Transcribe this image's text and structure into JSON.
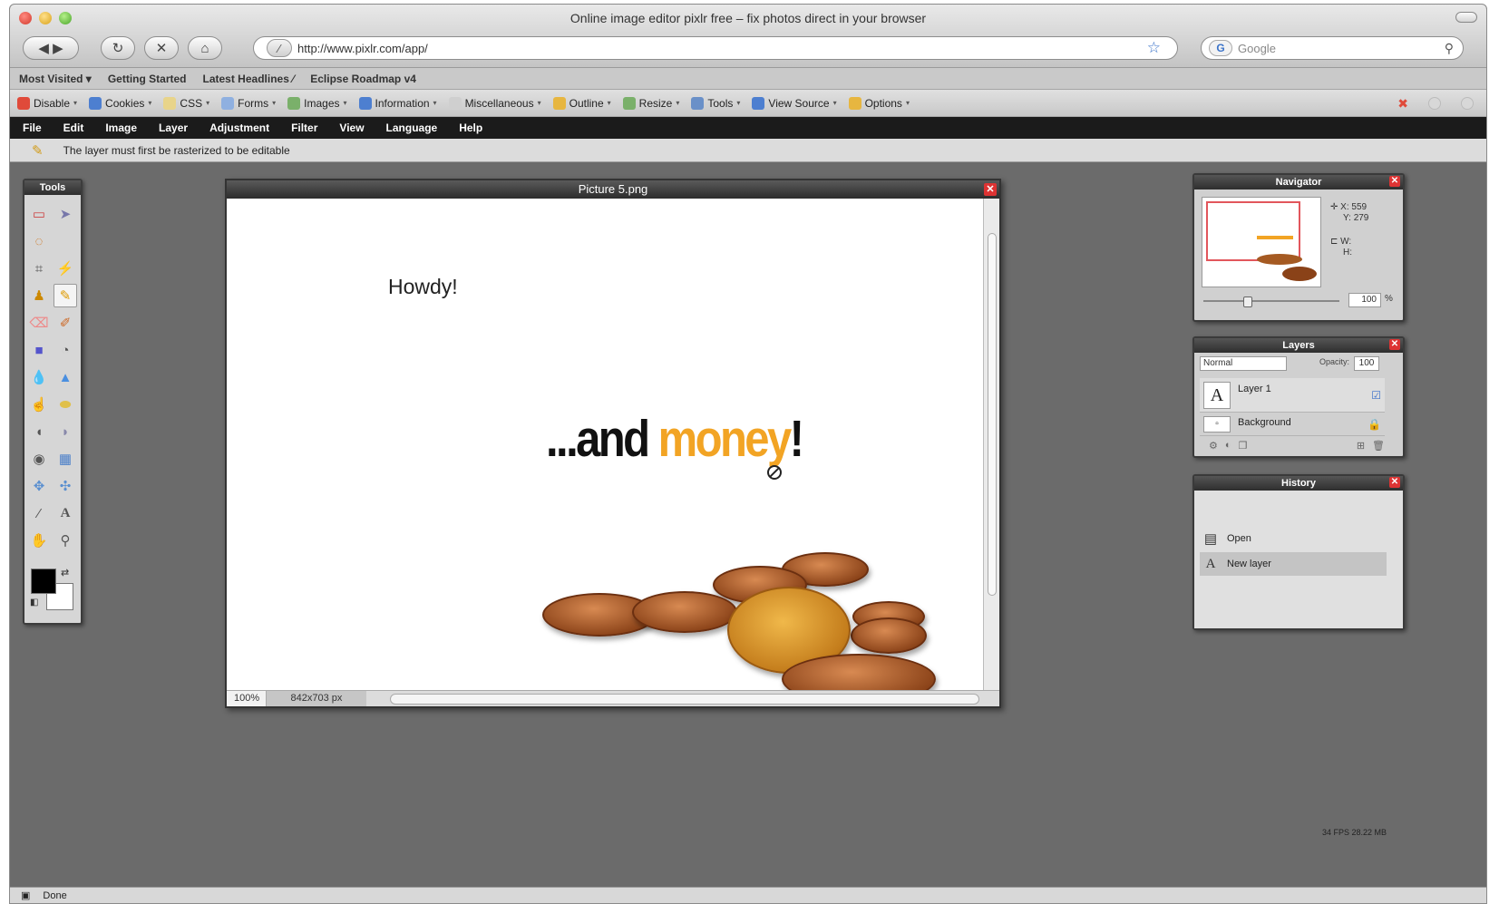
{
  "browser": {
    "window_title": "Online image editor pixlr free – fix photos direct in your browser",
    "url": "http://www.pixlr.com/app/",
    "search_placeholder": "Google",
    "search_engine_letter": "G",
    "status": "Done"
  },
  "bookmarks": [
    "Most Visited ▾",
    "Getting Started",
    "Latest Headlines ⁄",
    "Eclipse Roadmap v4"
  ],
  "devbar": [
    {
      "label": "Disable",
      "color": "#e04a3a"
    },
    {
      "label": "Cookies",
      "color": "#4d7fd0"
    },
    {
      "label": "CSS",
      "color": "#e8d48a"
    },
    {
      "label": "Forms",
      "color": "#8fb0e0"
    },
    {
      "label": "Images",
      "color": "#7ab06a"
    },
    {
      "label": "Information",
      "color": "#4d7fd0"
    },
    {
      "label": "Miscellaneous",
      "color": "#cfcfcf"
    },
    {
      "label": "Outline",
      "color": "#e7b640"
    },
    {
      "label": "Resize",
      "color": "#7ab06a"
    },
    {
      "label": "Tools",
      "color": "#6a90c8"
    },
    {
      "label": "View Source",
      "color": "#4d7fd0"
    },
    {
      "label": "Options",
      "color": "#e7b640"
    }
  ],
  "app_menu": [
    "File",
    "Edit",
    "Image",
    "Layer",
    "Adjustment",
    "Filter",
    "View",
    "Language",
    "Help"
  ],
  "hint": "The layer must first be rasterized to be editable",
  "tools_panel": {
    "title": "Tools"
  },
  "document": {
    "title": "Picture 5.png",
    "zoom": "100%",
    "size": "842x703 px",
    "canvas_text_1": "Howdy!",
    "canvas_text_2a": "...and ",
    "canvas_text_2b": "money",
    "canvas_text_2c": "!"
  },
  "navigator": {
    "title": "Navigator",
    "x_label": "X:",
    "x": "559",
    "y_label": "Y:",
    "y": "279",
    "w_label": "W:",
    "h_label": "H:",
    "zoom": "100",
    "pct": "%"
  },
  "layers": {
    "title": "Layers",
    "mode": "Normal",
    "opacity_label": "Opacity:",
    "opacity": "100",
    "items": [
      "Layer 1",
      "Background"
    ]
  },
  "history": {
    "title": "History",
    "items": [
      "Open",
      "New layer"
    ]
  },
  "fps_text": "34 FPS 28.22 MB",
  "colors": {
    "accent_gold": "#f2a424",
    "menubar": "#1b1b1b",
    "workspace": "#6b6b6b"
  }
}
